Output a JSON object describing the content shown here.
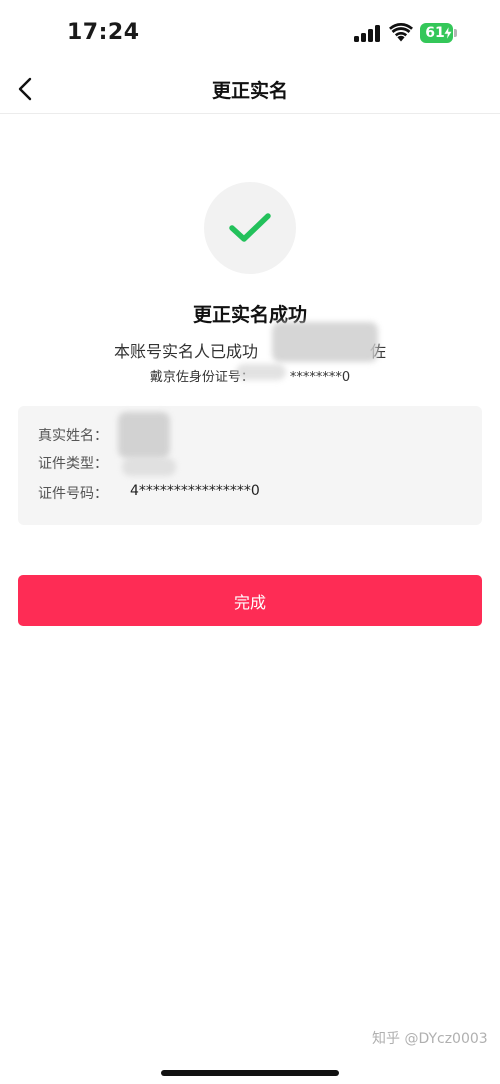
{
  "status_bar": {
    "time": "17:24",
    "battery_level": "61",
    "battery_color": "#34c759",
    "icons": [
      "signal-icon",
      "wifi-icon",
      "battery-icon"
    ]
  },
  "nav": {
    "title": "更正实名",
    "back_icon": "chevron-left-icon"
  },
  "success": {
    "icon": "checkmark-icon",
    "icon_color": "#23c15b",
    "title": "更正实名成功",
    "description": "本账号实名人已成功",
    "description_tail": "佐",
    "id_line_prefix": "戴京佐身份证号：",
    "id_line_suffix": "********0"
  },
  "info": {
    "rows": [
      {
        "label": "真实姓名：",
        "value": ""
      },
      {
        "label": "证件类型：",
        "value": ""
      },
      {
        "label": "证件号码：",
        "value": "4****************0"
      }
    ]
  },
  "actions": {
    "done_label": "完成",
    "primary_color": "#fe2c55"
  },
  "watermark": "知乎 @DYcz0003"
}
